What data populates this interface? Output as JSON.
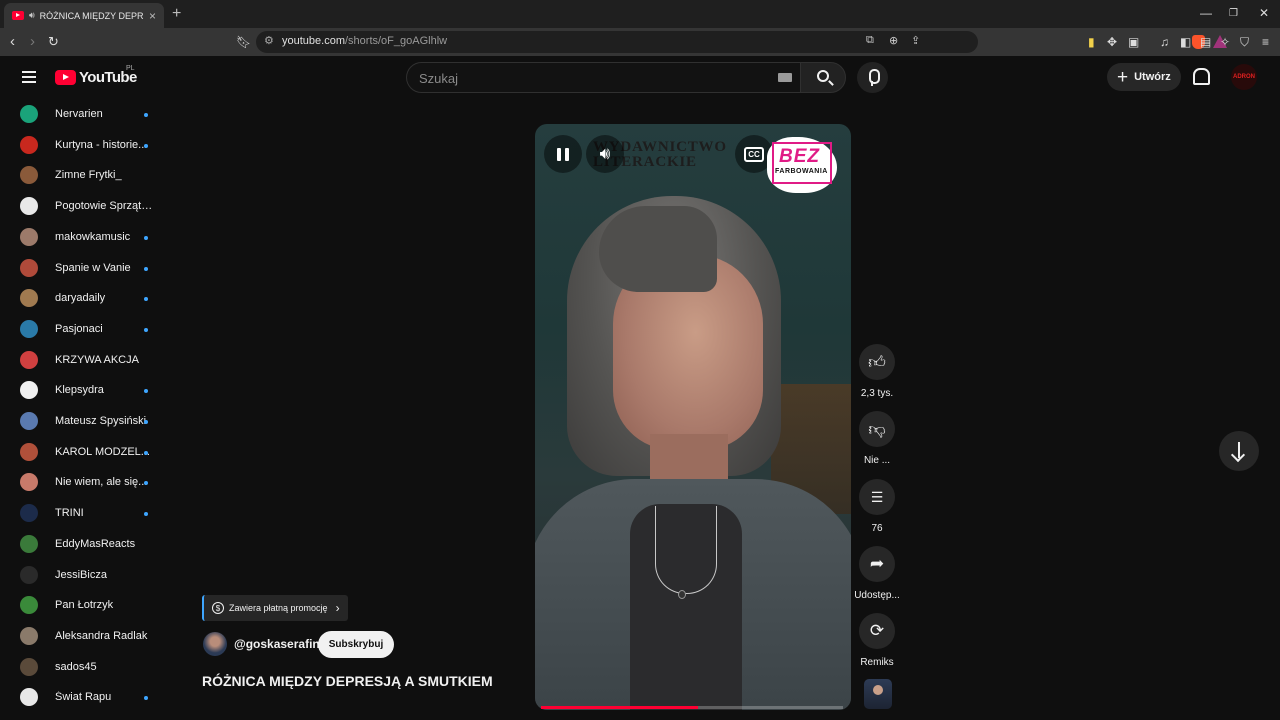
{
  "browser": {
    "tab_title": "RÓŻNICA MIĘDZY DEPRESJĄ",
    "url_host": "youtube.com",
    "url_path": "/shorts/oF_goAGlhlw"
  },
  "masthead": {
    "logo_text": "YouTube",
    "country_code": "PL",
    "search_placeholder": "Szukaj",
    "create_label": "Utwórz",
    "account_text": "ADRON"
  },
  "sidebar": {
    "subscriptions": [
      {
        "name": "Nervarien",
        "new": true,
        "color": "#1aa37a"
      },
      {
        "name": "Kurtyna - historie...",
        "new": true,
        "color": "#c8281e"
      },
      {
        "name": "Zimne Frytki_",
        "new": false,
        "color": "#8a5a3a"
      },
      {
        "name": "Pogotowie Sprzątaj...",
        "new": false,
        "color": "#e8e8e8"
      },
      {
        "name": "makowkamusic",
        "new": true,
        "color": "#9c7a6a"
      },
      {
        "name": "Spanie w Vanie",
        "new": true,
        "color": "#b04a3a"
      },
      {
        "name": "daryadaily",
        "new": true,
        "color": "#a07a50"
      },
      {
        "name": "Pasjonaci",
        "new": true,
        "color": "#2a7aa8"
      },
      {
        "name": "KRZYWA AKCJA",
        "new": false,
        "color": "#d04040"
      },
      {
        "name": "Klepsydra",
        "new": true,
        "color": "#f0f0f0"
      },
      {
        "name": "Mateusz Spysiński",
        "new": true,
        "color": "#5a7ab0"
      },
      {
        "name": "KAROL MODZEL...",
        "new": true,
        "color": "#b0503a"
      },
      {
        "name": "Nie wiem, ale się...",
        "new": true,
        "color": "#c87a6a"
      },
      {
        "name": "TRINI",
        "new": true,
        "color": "#1c2b4a"
      },
      {
        "name": "EddyMasReacts",
        "new": false,
        "color": "#3a7a3a"
      },
      {
        "name": "JessiBicza",
        "new": false,
        "color": "#2a2a2a"
      },
      {
        "name": "Pan Łotrzyk",
        "new": false,
        "color": "#3a8a3a"
      },
      {
        "name": "Aleksandra Radlak",
        "new": false,
        "color": "#8a7a6a"
      },
      {
        "name": "sados45",
        "new": false,
        "color": "#5a4a3a"
      },
      {
        "name": "Świat Rapu",
        "new": true,
        "color": "#e8e8e8"
      }
    ]
  },
  "short": {
    "overlay_brand_lines": [
      "WYDAWNICTWO",
      "LITERACKIE"
    ],
    "logo_main": "BEZ",
    "logo_sub": "FARBOWANIA",
    "progress_fraction": 0.52,
    "promo_label": "Zawiera płatną promocję",
    "channel_handle": "@goskaserafin",
    "subscribe_label": "Subskrybuj",
    "title": "RÓŻNICA MIĘDZY DEPRESJĄ A SMUTKIEM"
  },
  "actions": {
    "like_count": "2,3 tys.",
    "dislike_label": "Nie ...",
    "comment_count": "76",
    "share_label": "Udostęp...",
    "remix_label": "Remiks"
  }
}
